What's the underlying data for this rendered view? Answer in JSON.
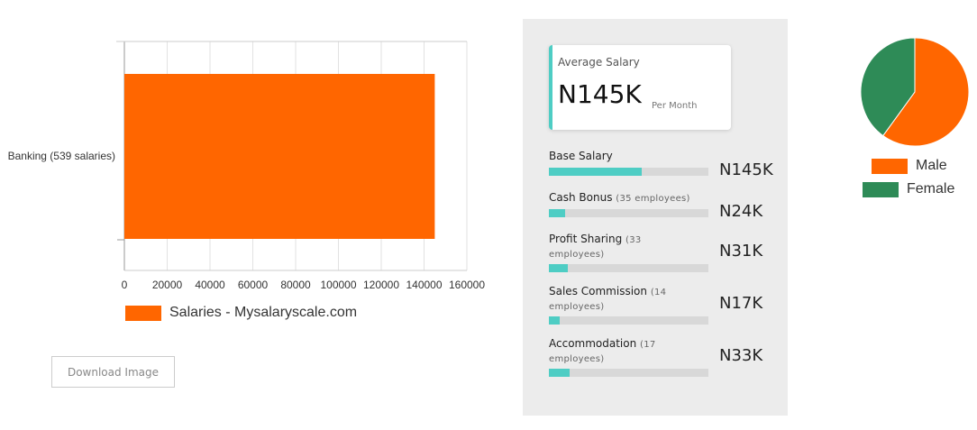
{
  "colors": {
    "bar": "#ff6600",
    "accent": "#4ecdc4",
    "male": "#ff6600",
    "female": "#2e8b57",
    "panel_bg": "#ececec"
  },
  "chart_data": [
    {
      "type": "bar",
      "orientation": "horizontal",
      "categories": [
        "Banking (539 salaries)"
      ],
      "series": [
        {
          "name": "Salaries - Mysalaryscale.com",
          "values": [
            145000
          ]
        }
      ],
      "xlim": [
        0,
        160000
      ],
      "ticks": [
        "0",
        "20000",
        "40000",
        "60000",
        "80000",
        "100000",
        "120000",
        "140000",
        "160000"
      ],
      "grid": true,
      "legend": "bottom"
    },
    {
      "type": "pie",
      "categories": [
        "Male",
        "Female"
      ],
      "values": [
        60,
        40
      ],
      "legend": "bottom"
    }
  ],
  "download_label": "Download Image",
  "avg": {
    "title": "Average Salary",
    "value": "N145K",
    "unit": "Per Month"
  },
  "items": [
    {
      "label": "Base Salary",
      "sub": "",
      "value": "N145K",
      "fraction": 0.58
    },
    {
      "label": "Cash Bonus",
      "sub": "(35 employees)",
      "value": "N24K",
      "fraction": 0.1
    },
    {
      "label": "Profit Sharing",
      "sub": "(33 employees)",
      "value": "N31K",
      "fraction": 0.12
    },
    {
      "label": "Sales Commission",
      "sub": "(14 employees)",
      "value": "N17K",
      "fraction": 0.07
    },
    {
      "label": "Accommodation",
      "sub": "(17 employees)",
      "value": "N33K",
      "fraction": 0.13
    }
  ]
}
